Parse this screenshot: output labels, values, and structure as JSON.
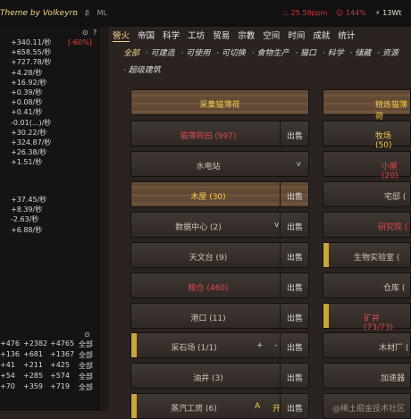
{
  "header": {
    "theme": "Theme by Volkeyrn",
    "icons": [
      "c",
      "β",
      "ML"
    ],
    "ppm": "25.59ppm",
    "percent": "144%",
    "energy": "13Wt"
  },
  "left": {
    "header_icons": [
      "⊙",
      "?"
    ],
    "warning": "[-60%]",
    "rates_a": [
      "+340.11/秒",
      "+658.55/秒",
      "+727.78/秒",
      "+4.28/秒",
      "+16.92/秒",
      "+0.39/秒",
      "+0.08/秒",
      "+0.41/秒",
      "-0.01(...)/秒",
      "+30.22/秒",
      "+324.87/秒",
      "+26.38/秒",
      "+1.51/秒"
    ],
    "rates_b": [
      "+37.45/秒",
      "+8.39/秒",
      "-2.63/秒",
      "+6.88/秒"
    ],
    "table_icon": "⊙",
    "table": [
      [
        "+476",
        "+2382",
        "+4765",
        "全部"
      ],
      [
        "+136",
        "+681",
        "+1367",
        "全部"
      ],
      [
        "+41",
        "+211",
        "+425",
        "全部"
      ],
      [
        "+54",
        "+285",
        "+574",
        "全部"
      ],
      [
        "+70",
        "+359",
        "+719",
        "全部"
      ]
    ]
  },
  "tabs": [
    "營火",
    "帝国",
    "科学",
    "工坊",
    "贸易",
    "宗教",
    "空间",
    "时间",
    "成就",
    "统计"
  ],
  "filters": [
    "全部",
    "· 可建造",
    "· 可使用",
    "· 可切换",
    "· 食物生产",
    "· 猫口",
    "· 科学",
    "· 储藏",
    "· 资源",
    "· 超级建筑"
  ],
  "buttons": {
    "gather": "采集猫薄荷",
    "refine": "精炼猫薄荷",
    "field": "猫薄荷田 (997)",
    "pasture": "牧场 (50)",
    "hydro": "水电站",
    "hut": "小屋 (20)",
    "loghouse": "木屋 (30)",
    "mansion": "宅邸 (",
    "datacenter": "数据中心 (2)",
    "lab": "研究院 (",
    "observatory": "天文台 (9)",
    "biolab": "生物实验室 (",
    "barn": "粮仓 (460)",
    "warehouse": "仓库 (",
    "harbor": "港口 (11)",
    "mine": "矿井 (73/73)",
    "quarry": "采石场 (1/1)",
    "lumbermill": "木材厂 (",
    "oilwell": "油井 (3)",
    "accelerator": "加速器",
    "steamworks": "蒸汽工房 (6)",
    "sell": "出售",
    "v": "v",
    "plus": "+",
    "minus": "-",
    "auto": "A",
    "toggle": "开",
    "watermark": "@稀土掘金技术社区"
  },
  "colors": {
    "accent_gold": "#f4d58a",
    "red": "#e0484e",
    "panel": "#2b231f"
  }
}
